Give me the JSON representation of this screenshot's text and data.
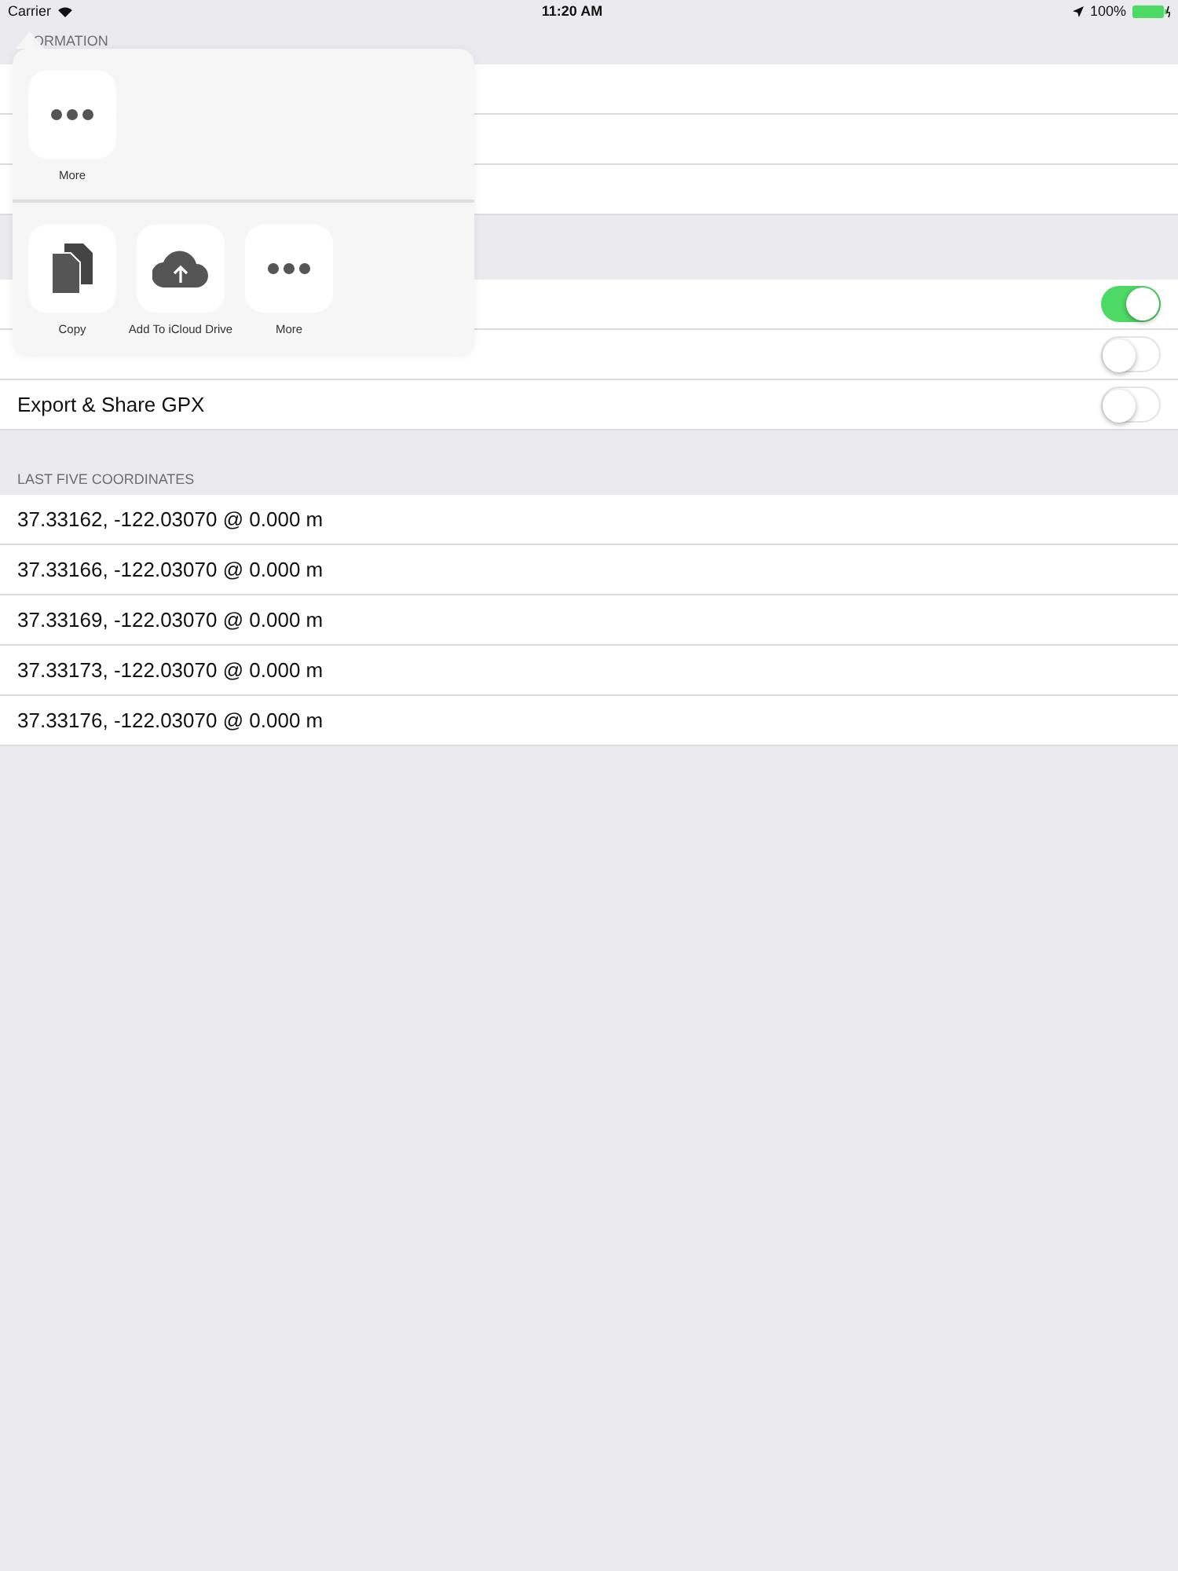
{
  "status_bar": {
    "carrier": "Carrier",
    "time": "11:20 AM",
    "battery": "100%"
  },
  "sections": [
    {
      "header": "ORMATION",
      "rows": [
        {
          "kind": "plain"
        },
        {
          "kind": "plain"
        },
        {
          "kind": "plain"
        }
      ]
    },
    {
      "rows": [
        {
          "kind": "toggle",
          "on": true
        },
        {
          "kind": "toggle",
          "on": false
        },
        {
          "kind": "toggle",
          "label": "Export & Share GPX",
          "on": false
        }
      ]
    },
    {
      "header": "LAST FIVE COORDINATES",
      "rows": [
        {
          "kind": "plain",
          "label": "37.33162, -122.03070 @ 0.000 m"
        },
        {
          "kind": "plain",
          "label": "37.33166, -122.03070 @ 0.000 m"
        },
        {
          "kind": "plain",
          "label": "37.33169, -122.03070 @ 0.000 m"
        },
        {
          "kind": "plain",
          "label": "37.33173, -122.03070 @ 0.000 m"
        },
        {
          "kind": "plain",
          "label": "37.33176, -122.03070 @ 0.000 m"
        }
      ]
    }
  ],
  "share_sheet": {
    "rows": [
      [
        {
          "kind": "more",
          "label": "More"
        }
      ],
      [
        {
          "kind": "copy",
          "label": "Copy"
        },
        {
          "kind": "cloud",
          "label": "Add To iCloud Drive"
        },
        {
          "kind": "more",
          "label": "More"
        }
      ]
    ]
  }
}
